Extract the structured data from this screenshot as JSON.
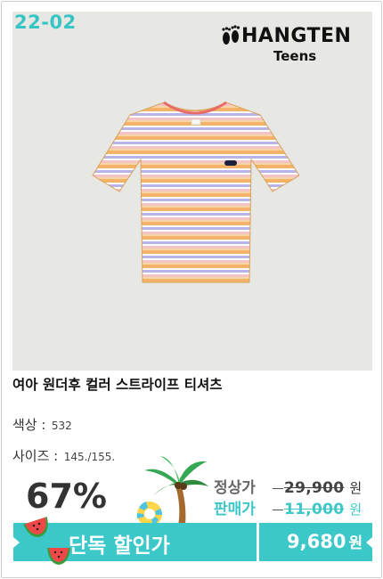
{
  "product": {
    "code": "22-02",
    "brand_name": "HANGTEN",
    "brand_sub": "Teens",
    "title": "여아 원더후 컬러 스트라이프 티셔츠",
    "color_label": "색상 :",
    "color_value": "532",
    "size_label": "사이즈 :",
    "size_value": "145./155."
  },
  "pricing": {
    "discount": "67%",
    "regular_label": "정상가",
    "regular_price": "29,900",
    "sale_label": "판매가",
    "sale_price": "11,000",
    "currency": "원"
  },
  "banner": {
    "label": "단독 할인가",
    "price": "9,680",
    "currency": "원"
  },
  "colors": {
    "accent": "#3cc7c9",
    "photo_bg": "#e7e7e3"
  },
  "icons": [
    "footprint-logo-icon",
    "palm-tree-icon",
    "swim-ring-icon",
    "watermelon-icon"
  ]
}
